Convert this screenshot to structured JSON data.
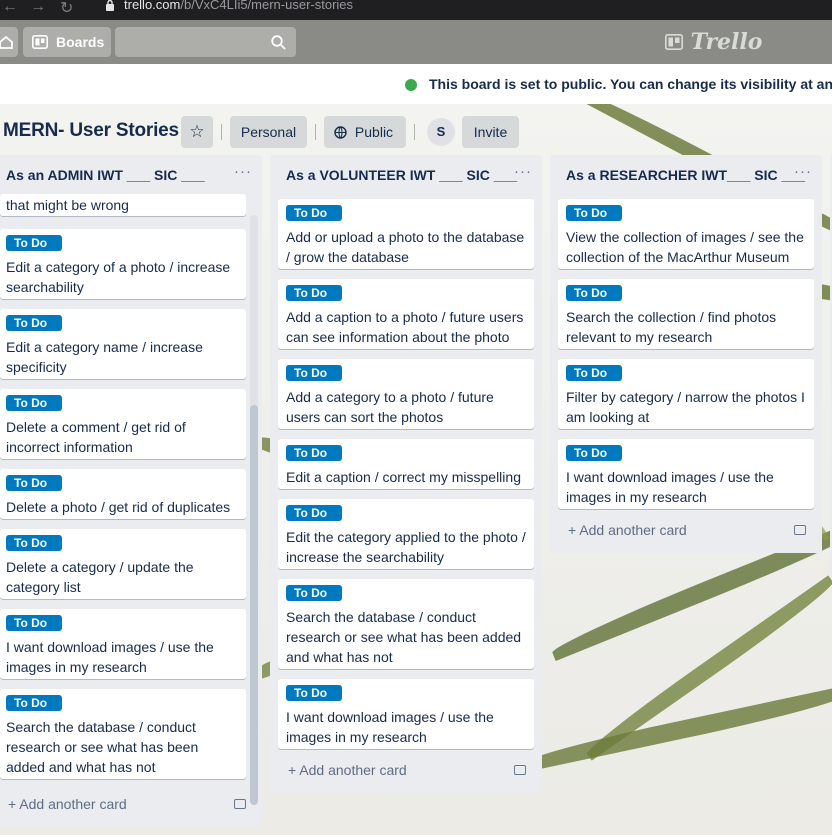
{
  "browser": {
    "url_host": "trello.com",
    "url_path": "/b/VxC4LIi5/mern-user-stories"
  },
  "topbar": {
    "boards_label": "Boards",
    "logo_text": "Trello"
  },
  "notice": {
    "text": "This board is set to public. You can change its visibility at any t"
  },
  "board": {
    "title": "MERN- User Stories",
    "team_label": "Personal",
    "visibility_label": "Public",
    "member_initial": "S",
    "invite_label": "Invite"
  },
  "colors": {
    "label_blue": "#0079bf",
    "list_bg": "#ebecf0",
    "topbar": "#8a8b86"
  },
  "lists": [
    {
      "title": "As an ADMIN IWT ___ SIC ___",
      "menu": "···",
      "cards": [
        {
          "label": "",
          "text": "that might be wrong"
        },
        {
          "label": "To Do",
          "text": "Edit a category of a photo / increase searchability"
        },
        {
          "label": "To Do",
          "text": "Edit a category name / increase specificity"
        },
        {
          "label": "To Do",
          "text": "Delete a comment / get rid of incorrect information"
        },
        {
          "label": "To Do",
          "text": "Delete a photo / get rid of duplicates"
        },
        {
          "label": "To Do",
          "text": "Delete a category / update the category list"
        },
        {
          "label": "To Do",
          "text": "I want download images / use the images in my research"
        },
        {
          "label": "To Do",
          "text": "Search the database / conduct research or see what has been added and what has not"
        }
      ],
      "add_label": "+ Add another card"
    },
    {
      "title": "As a VOLUNTEER IWT ___ SIC ___",
      "menu": "···",
      "cards": [
        {
          "label": "To Do",
          "text": "Add or upload a photo to the database / grow the database"
        },
        {
          "label": "To Do",
          "text": "Add a caption to a photo / future users can see information about the photo"
        },
        {
          "label": "To Do",
          "text": "Add a category to a photo / future users can sort the photos"
        },
        {
          "label": "To Do",
          "text": "Edit a caption / correct my misspelling"
        },
        {
          "label": "To Do",
          "text": "Edit the category applied to the photo / increase the searchability"
        },
        {
          "label": "To Do",
          "text": "Search the database / conduct research or see what has been added and what has not"
        },
        {
          "label": "To Do",
          "text": "I want download images / use the images in my research"
        }
      ],
      "add_label": "+ Add another card"
    },
    {
      "title": "As a RESEARCHER IWT___ SIC ___",
      "menu": "···",
      "cards": [
        {
          "label": "To Do",
          "text": "View the collection of images / see the collection of the MacArthur Museum"
        },
        {
          "label": "To Do",
          "text": "Search the collection / find photos relevant to my research"
        },
        {
          "label": "To Do",
          "text": "Filter by category / narrow the photos I am looking at"
        },
        {
          "label": "To Do",
          "text": "I want download images / use the images in my research"
        }
      ],
      "add_label": "+ Add another card"
    }
  ]
}
